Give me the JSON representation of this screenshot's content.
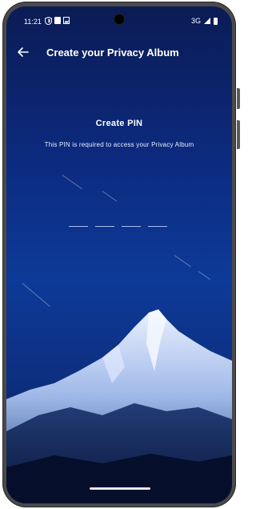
{
  "status_bar": {
    "time": "11:21",
    "network": "3G"
  },
  "app_bar": {
    "title": "Create your Privacy Album"
  },
  "pin": {
    "title": "Create PIN",
    "subtitle": "This PIN is required to access your Privacy Album",
    "digits": [
      "",
      "",
      "",
      ""
    ]
  },
  "icons": {
    "back": "arrow-left-icon",
    "shield": "shield-icon",
    "sim": "sim-icon",
    "media": "photo-icon",
    "signal": "signal-icon",
    "battery": "battery-icon"
  },
  "colors": {
    "background_top": "#0b1b54",
    "background_mid": "#0d3a98",
    "text": "#ffffff"
  }
}
